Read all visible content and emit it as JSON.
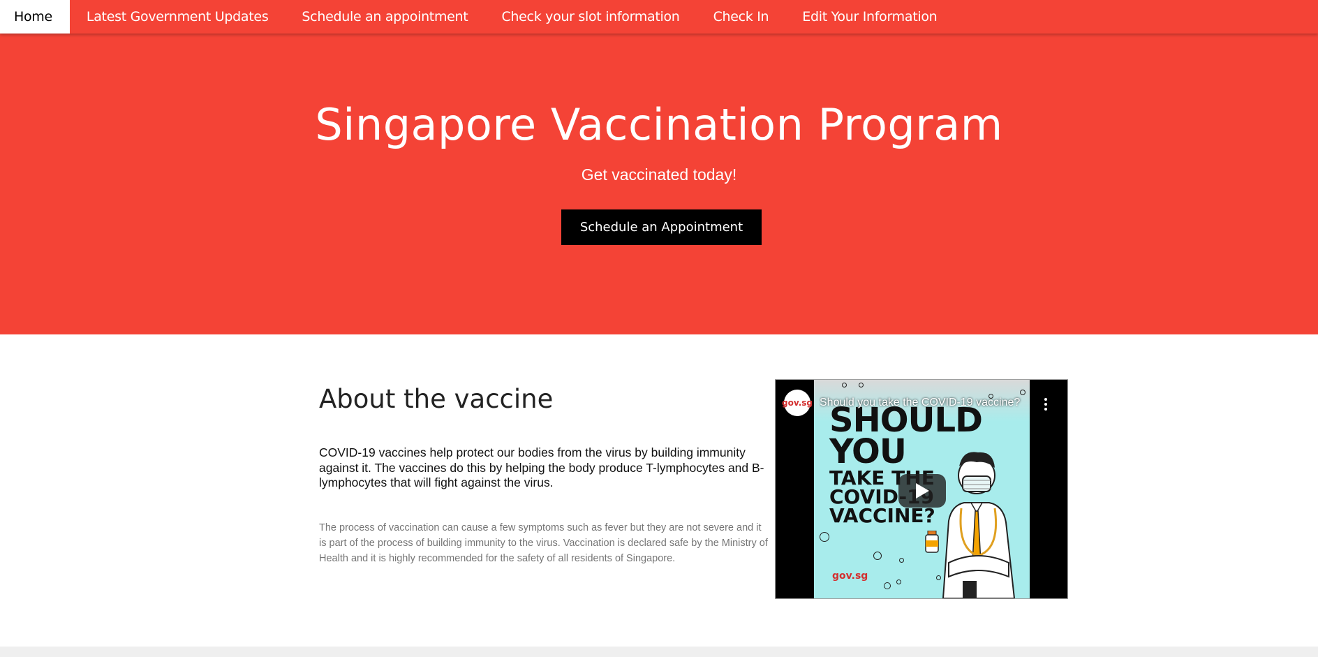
{
  "nav": {
    "items": [
      {
        "label": "Home",
        "active": true
      },
      {
        "label": "Latest Government Updates"
      },
      {
        "label": "Schedule an appointment"
      },
      {
        "label": "Check your slot information"
      },
      {
        "label": "Check In"
      },
      {
        "label": "Edit Your Information"
      }
    ]
  },
  "hero": {
    "title": "Singapore Vaccination Program",
    "subtitle": "Get vaccinated today!",
    "button_label": "Schedule an Appointment"
  },
  "about": {
    "title": "About the vaccine",
    "paragraph1": "COVID-19 vaccines help protect our bodies from the virus by building immunity against it. The vaccines do this by helping the body produce T-lymphocytes and B-lymphocytes that will fight against the virus.",
    "paragraph2": "The process of vaccination can cause a few symptoms such as fever but they are not severe and it is part of the process of building immunity to the virus. Vaccination is declared safe by the Ministry of Health and it is highly recommended for the safety of all residents of Singapore."
  },
  "video": {
    "title": "Should you take the COVID-19 vaccine?",
    "channel_logo": "gov.sg",
    "thumbnail_lines": [
      "SHOULD",
      "YOU",
      "TAKE THE",
      "COVID-19",
      "VACCINE?"
    ],
    "watermark": "gov.sg",
    "icons": [
      "play-icon",
      "more-vert-icon",
      "doctor-illustration-icon"
    ]
  },
  "colors": {
    "primary": "#f44336",
    "button": "#000000",
    "footer": "#efefef"
  }
}
